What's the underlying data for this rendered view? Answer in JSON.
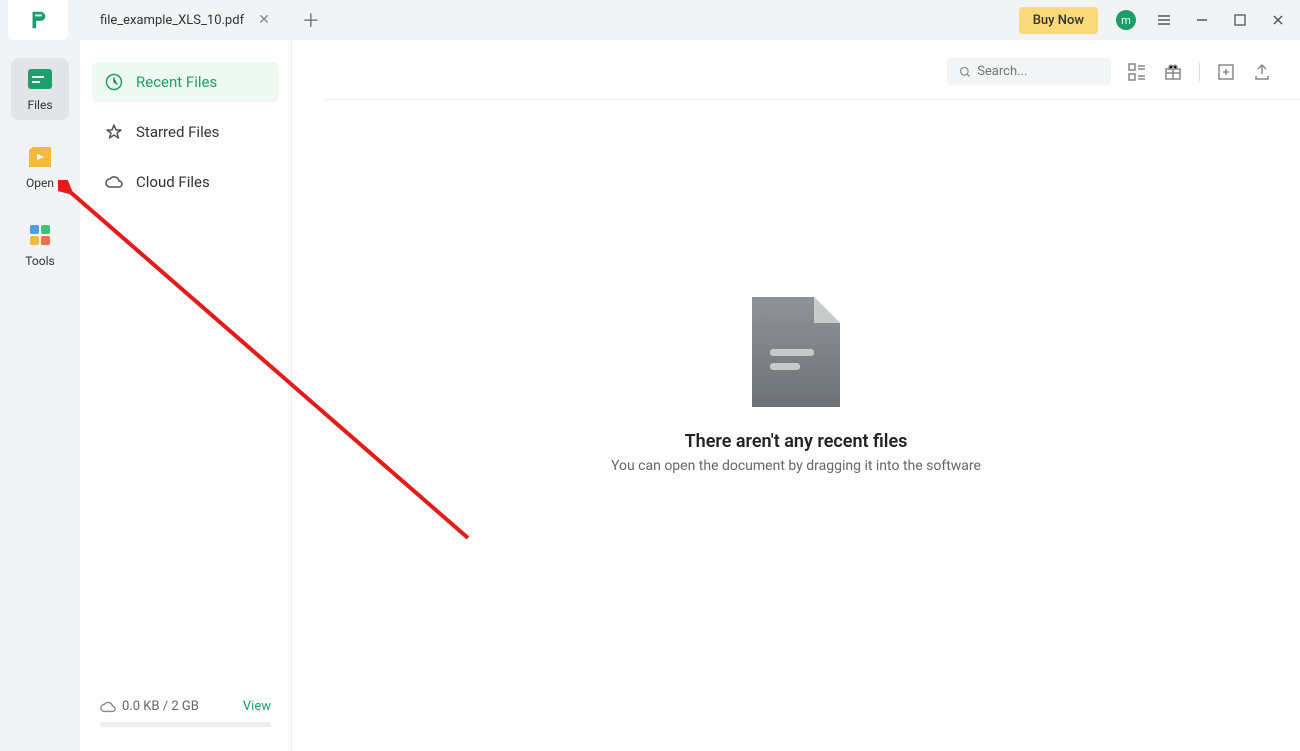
{
  "titlebar": {
    "tab_name": "file_example_XLS_10.pdf",
    "buy_now": "Buy Now",
    "avatar_letter": "m"
  },
  "sidebar_narrow": {
    "files": "Files",
    "open": "Open",
    "tools": "Tools"
  },
  "sidebar_wide": {
    "recent": "Recent Files",
    "starred": "Starred Files",
    "cloud": "Cloud Files",
    "storage": "0.0 KB / 2 GB",
    "view": "View"
  },
  "toolbar": {
    "search_placeholder": "Search..."
  },
  "empty": {
    "title": "There aren't any recent files",
    "subtitle": "You can open the document by dragging it into the software"
  }
}
